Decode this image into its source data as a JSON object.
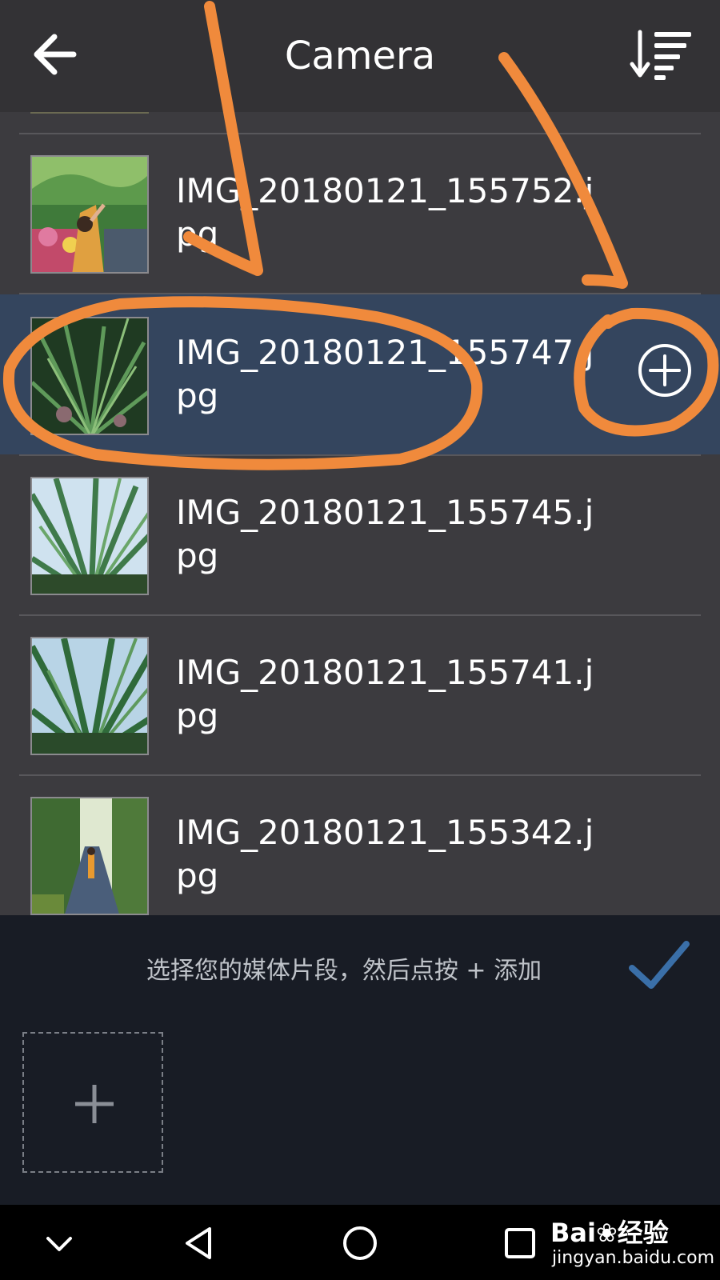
{
  "header": {
    "title": "Camera",
    "back_icon": "arrow-left-icon",
    "sort_icon": "sort-descending-icon"
  },
  "files": [
    {
      "name": "IMG_20180121_155752.jpg",
      "selected": false
    },
    {
      "name": "IMG_20180121_155747.jpg",
      "selected": true
    },
    {
      "name": "IMG_20180121_155745.jpg",
      "selected": false
    },
    {
      "name": "IMG_20180121_155741.jpg",
      "selected": false
    },
    {
      "name": "IMG_20180121_155342.jpg",
      "selected": false
    }
  ],
  "bottom_panel": {
    "hint": "选择您的媒体片段，然后点按 + 添加",
    "confirm_icon": "checkmark-icon",
    "add_slot_icon": "plus-icon"
  },
  "navbar": {
    "items": [
      "chevron-down-icon",
      "back-triangle-icon",
      "home-circle-icon",
      "recents-square-icon"
    ]
  },
  "watermark": {
    "logo": "Bai❀经验",
    "url": "jingyan.baidu.com"
  },
  "colors": {
    "header_bg": "#333235",
    "list_bg": "#3c3b3f",
    "selected_row_bg": "#34455e",
    "bottom_panel_bg": "#181c25",
    "confirm_check": "#3a6fa8",
    "annotation": "#f08a3c"
  }
}
